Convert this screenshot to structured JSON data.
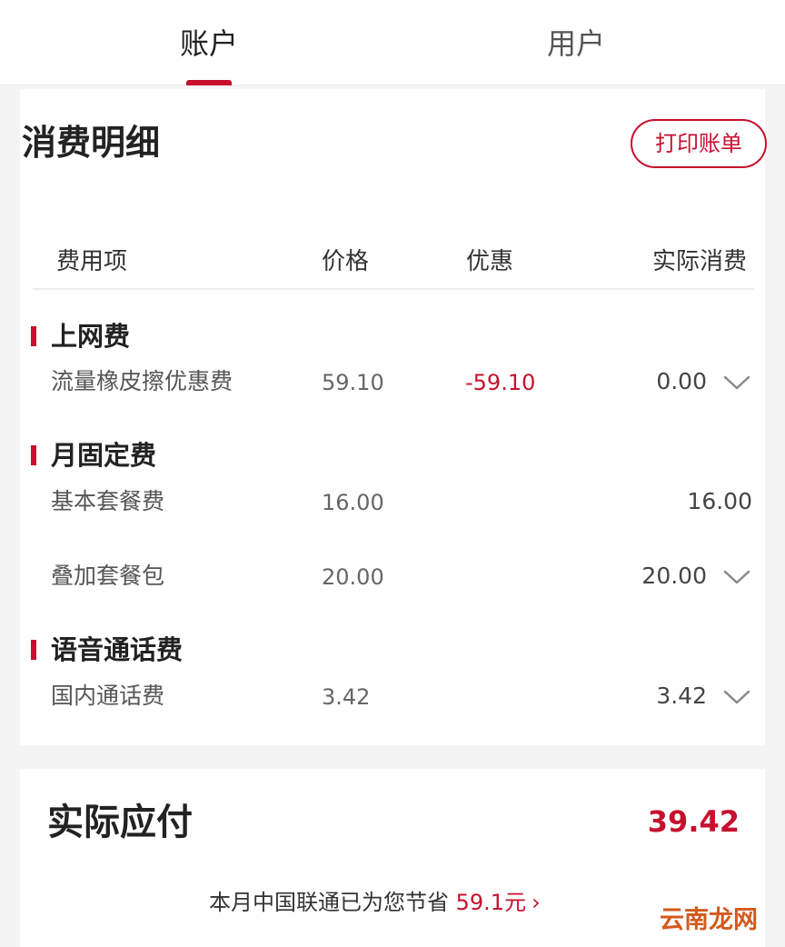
{
  "tabs": [
    {
      "label": "账户",
      "active": true
    },
    {
      "label": "用户",
      "active": false
    }
  ],
  "detail": {
    "title": "消费明细",
    "print_button": "打印账单",
    "columns": {
      "item": "费用项",
      "price": "价格",
      "discount": "优惠",
      "actual": "实际消费"
    },
    "sections": [
      {
        "title": "上网费",
        "rows": [
          {
            "name": "流量橡皮擦优惠费",
            "price": "59.10",
            "discount": "-59.10",
            "actual": "0.00",
            "expandable": true
          }
        ]
      },
      {
        "title": "月固定费",
        "rows": [
          {
            "name": "基本套餐费",
            "price": "16.00",
            "discount": "",
            "actual": "16.00",
            "expandable": false
          },
          {
            "name": "叠加套餐包",
            "price": "20.00",
            "discount": "",
            "actual": "20.00",
            "expandable": true
          }
        ]
      },
      {
        "title": "语音通话费",
        "rows": [
          {
            "name": "国内通话费",
            "price": "3.42",
            "discount": "",
            "actual": "3.42",
            "expandable": true
          }
        ]
      }
    ]
  },
  "summary": {
    "label": "实际应付",
    "amount": "39.42",
    "savings_prefix": "本月中国联通已为您节省",
    "savings_amount": "59.1元",
    "savings_chevron": "›"
  },
  "watermark": "云南龙网",
  "colors": {
    "accent": "#c8102e",
    "watermark": "#d35a1d"
  },
  "icons": {
    "expand": "chevron-down-icon",
    "more": "chevron-right-icon"
  }
}
